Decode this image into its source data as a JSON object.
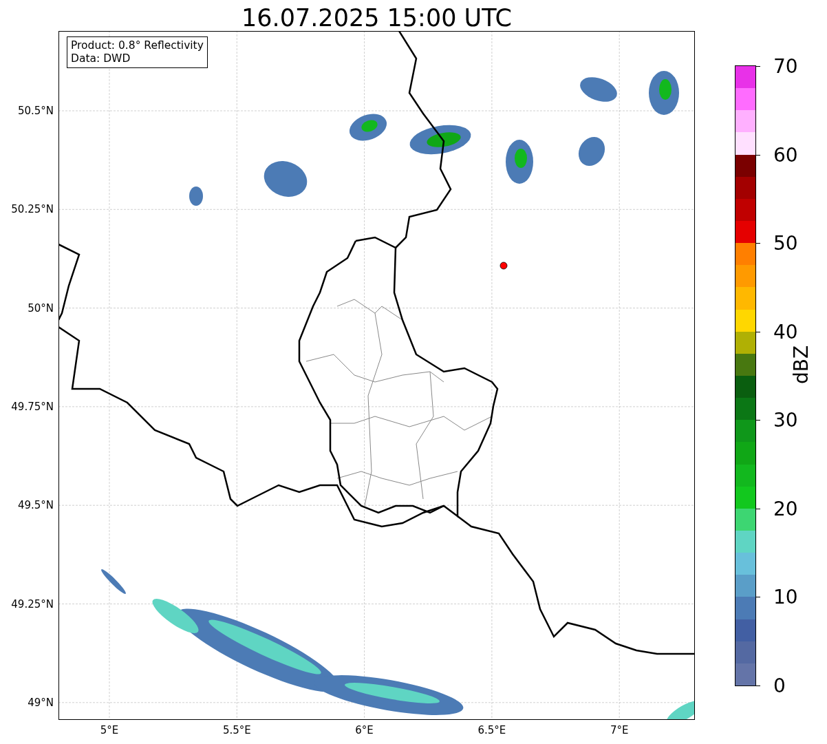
{
  "title": "16.07.2025 15:00 UTC",
  "info_box": [
    "Product: 0.8° Reflectivity",
    "Data: DWD"
  ],
  "lat_ticks": [
    "50.5°N",
    "50.25°N",
    "50°N",
    "49.75°N",
    "49.5°N",
    "49.25°N",
    "49°N"
  ],
  "lon_ticks": [
    "5°E",
    "5.5°E",
    "6°E",
    "6.5°E",
    "7°E"
  ],
  "colorbar": {
    "label": "dBZ",
    "ticks": [
      "70",
      "60",
      "50",
      "40",
      "30",
      "20",
      "10",
      "0"
    ],
    "bins": [
      {
        "color": "#e831e8"
      },
      {
        "color": "#ff6cff"
      },
      {
        "color": "#ffb0ff"
      },
      {
        "color": "#ffe0ff"
      },
      {
        "color": "#7a0000"
      },
      {
        "color": "#a30000"
      },
      {
        "color": "#c00000"
      },
      {
        "color": "#e50000"
      },
      {
        "color": "#ff7f00"
      },
      {
        "color": "#ff9a00"
      },
      {
        "color": "#ffb800"
      },
      {
        "color": "#ffd700"
      },
      {
        "color": "#b0b004"
      },
      {
        "color": "#487810"
      },
      {
        "color": "#0a5e0f"
      },
      {
        "color": "#0b7715"
      },
      {
        "color": "#0f971a"
      },
      {
        "color": "#10a716"
      },
      {
        "color": "#12b81e"
      },
      {
        "color": "#12c81e"
      },
      {
        "color": "#3dd672"
      },
      {
        "color": "#5fd5c3"
      },
      {
        "color": "#68c0db"
      },
      {
        "color": "#5a9ec8"
      },
      {
        "color": "#4c7bb5"
      },
      {
        "color": "#425fa3"
      },
      {
        "color": "#5469a2"
      },
      {
        "color": "#6474a8"
      }
    ]
  }
}
